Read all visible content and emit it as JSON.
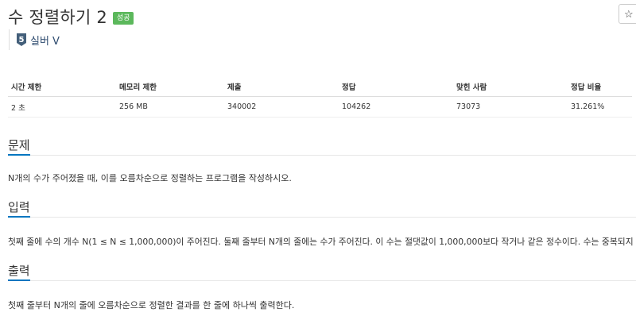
{
  "problem": {
    "title": "수 정렬하기 2",
    "badge": "성공",
    "tier_number": "5",
    "tier_label": "실버 V"
  },
  "colors": {
    "badge": "#5cb85c",
    "section_underline": "#0076c0",
    "tier_icon": "#435f7a"
  },
  "icons": {
    "star": "star-icon",
    "tier": "silver-tier-icon"
  },
  "star_glyph": "☆",
  "info_table": {
    "headers": [
      "시간 제한",
      "메모리 제한",
      "제출",
      "정답",
      "맞힌 사람",
      "정답 비율"
    ],
    "values": [
      "2 초",
      "256 MB",
      "340002",
      "104262",
      "73073",
      "31.261%"
    ]
  },
  "sections": {
    "problem": {
      "heading": "문제",
      "body": "N개의 수가 주어졌을 때, 이를 오름차순으로 정렬하는 프로그램을 작성하시오."
    },
    "input": {
      "heading": "입력",
      "body": "첫째 줄에 수의 개수 N(1 ≤ N ≤ 1,000,000)이 주어진다. 둘째 줄부터 N개의 줄에는 수가 주어진다. 이 수는 절댓값이 1,000,000보다 작거나 같은 정수이다. 수는 중복되지 않는다."
    },
    "output": {
      "heading": "출력",
      "body": "첫째 줄부터 N개의 줄에 오름차순으로 정렬한 결과를 한 줄에 하나씩 출력한다."
    }
  }
}
